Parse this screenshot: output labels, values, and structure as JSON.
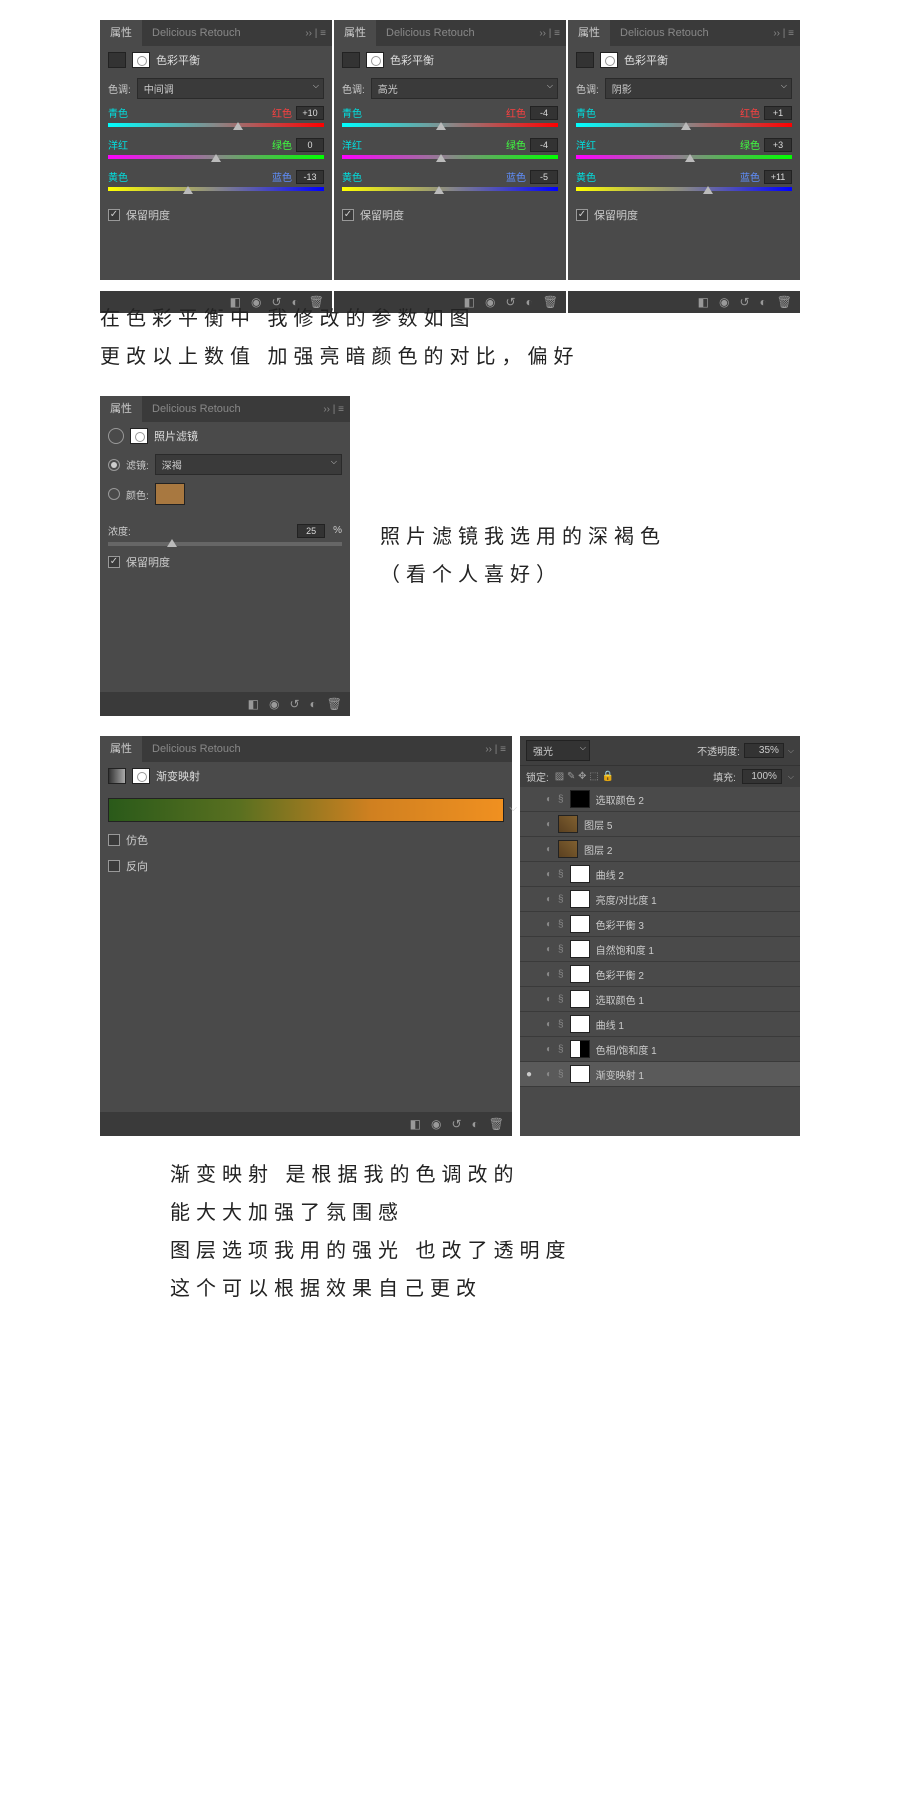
{
  "tabs": {
    "properties": "属性",
    "plugin": "Delicious Retouch",
    "end": "›› | ≡"
  },
  "cb_header": "色彩平衡",
  "tone_label": "色调:",
  "preserve_lum": "保留明度",
  "slider_labels": {
    "cyan": "青色",
    "red": "红色",
    "magenta": "洋红",
    "green": "绿色",
    "yellow": "黄色",
    "blue": "蓝色"
  },
  "panels": [
    {
      "tone": "中间调",
      "v": [
        "+10",
        "0",
        "-13"
      ],
      "pos": [
        60,
        50,
        37
      ]
    },
    {
      "tone": "高光",
      "v": [
        "-4",
        "-4",
        "-5"
      ],
      "pos": [
        46,
        46,
        45
      ]
    },
    {
      "tone": "阴影",
      "v": [
        "+1",
        "+3",
        "+11"
      ],
      "pos": [
        51,
        53,
        61
      ]
    }
  ],
  "ann1": [
    "在色彩平衡中 我修改的参数如图",
    "更改以上数值 加强亮暗颜色的对比，偏好"
  ],
  "photo_filter": {
    "header": "照片滤镜",
    "filter_label": "滤镜:",
    "filter_value": "深褐",
    "color_label": "颜色:",
    "density_label": "浓度:",
    "density_value": "25",
    "pct": "%"
  },
  "ann2": [
    "照片滤镜我选用的深褐色",
    "（看个人喜好）"
  ],
  "gradient": {
    "header": "渐变映射",
    "dither": "仿色",
    "reverse": "反向"
  },
  "layers_panel": {
    "blend_label": "强光",
    "opacity_label": "不透明度:",
    "opacity_val": "35%",
    "lock_label": "锁定:",
    "fill_label": "填充:",
    "fill_val": "100%",
    "layers": [
      {
        "name": "选取颜色 2",
        "eye": false,
        "thumb": "blk"
      },
      {
        "name": "图层 5",
        "eye": false,
        "thumb": "img",
        "nomask": true
      },
      {
        "name": "图层 2",
        "eye": false,
        "thumb": "img",
        "nomask": true
      },
      {
        "name": "曲线 2",
        "eye": false,
        "thumb": "white"
      },
      {
        "name": "亮度/对比度 1",
        "eye": false,
        "thumb": "white"
      },
      {
        "name": "色彩平衡 3",
        "eye": false,
        "thumb": "white"
      },
      {
        "name": "自然饱和度 1",
        "eye": false,
        "thumb": "white"
      },
      {
        "name": "色彩平衡 2",
        "eye": false,
        "thumb": "white"
      },
      {
        "name": "选取颜色 1",
        "eye": false,
        "thumb": "white"
      },
      {
        "name": "曲线 1",
        "eye": false,
        "thumb": "white"
      },
      {
        "name": "色相/饱和度 1",
        "eye": false,
        "thumb": "split"
      },
      {
        "name": "渐变映射 1",
        "eye": true,
        "thumb": "white",
        "sel": true
      }
    ]
  },
  "ann3": [
    "渐变映射 是根据我的色调改的",
    "能大大加强了氛围感",
    "图层选项我用的强光 也改了透明度",
    "这个可以根据效果自己更改"
  ]
}
